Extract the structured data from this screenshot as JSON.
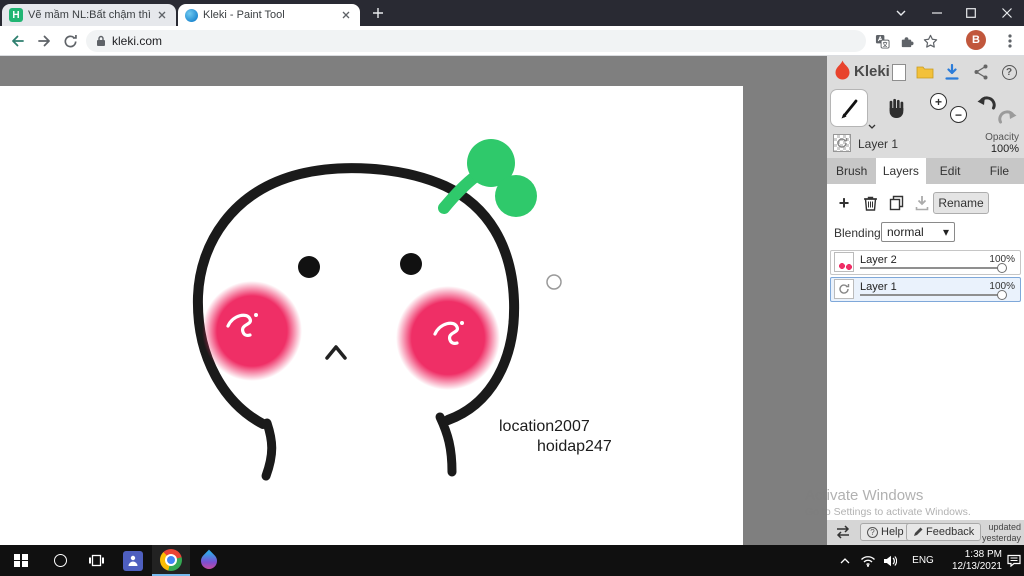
{
  "browser": {
    "tabs": [
      {
        "title": "Vẽ mầm NL:Bất chậm thì tại cach",
        "favicon_letter": "H"
      },
      {
        "title": "Kleki - Paint Tool"
      }
    ],
    "url": "kleki.com",
    "profile_initial": "B"
  },
  "kleki": {
    "brand": "Kleki",
    "active_layer_label": "Layer 1",
    "opacity_label": "Opacity",
    "opacity_value": "100%",
    "tabs": [
      "Brush",
      "Layers",
      "Edit",
      "File"
    ],
    "rename_button": "Rename",
    "blending_label": "Blending",
    "blending_value": "normal",
    "layers": [
      {
        "name": "Layer 2",
        "opacity": "100%"
      },
      {
        "name": "Layer 1",
        "opacity": "100%"
      }
    ],
    "help_label": "Help",
    "feedback_label": "Feedback",
    "updated_line1": "updated",
    "updated_line2": "yesterday"
  },
  "canvas": {
    "labels": [
      "location2007",
      "hoidap247"
    ]
  },
  "watermark": {
    "line1": "Activate Windows",
    "line2": "Go to Settings to activate Windows."
  },
  "taskbar": {
    "language": "ENG",
    "time": "1:38 PM",
    "date": "12/13/2021"
  },
  "icons": {
    "plus_glyph": "+",
    "minus_glyph": "−",
    "select_arrow": "▾",
    "help_glyph": "?"
  },
  "colors": {
    "sprout_green": "#2FC96B",
    "cheek_pink": "#EF2F66",
    "taskbar_accent": "#76B9ED"
  }
}
